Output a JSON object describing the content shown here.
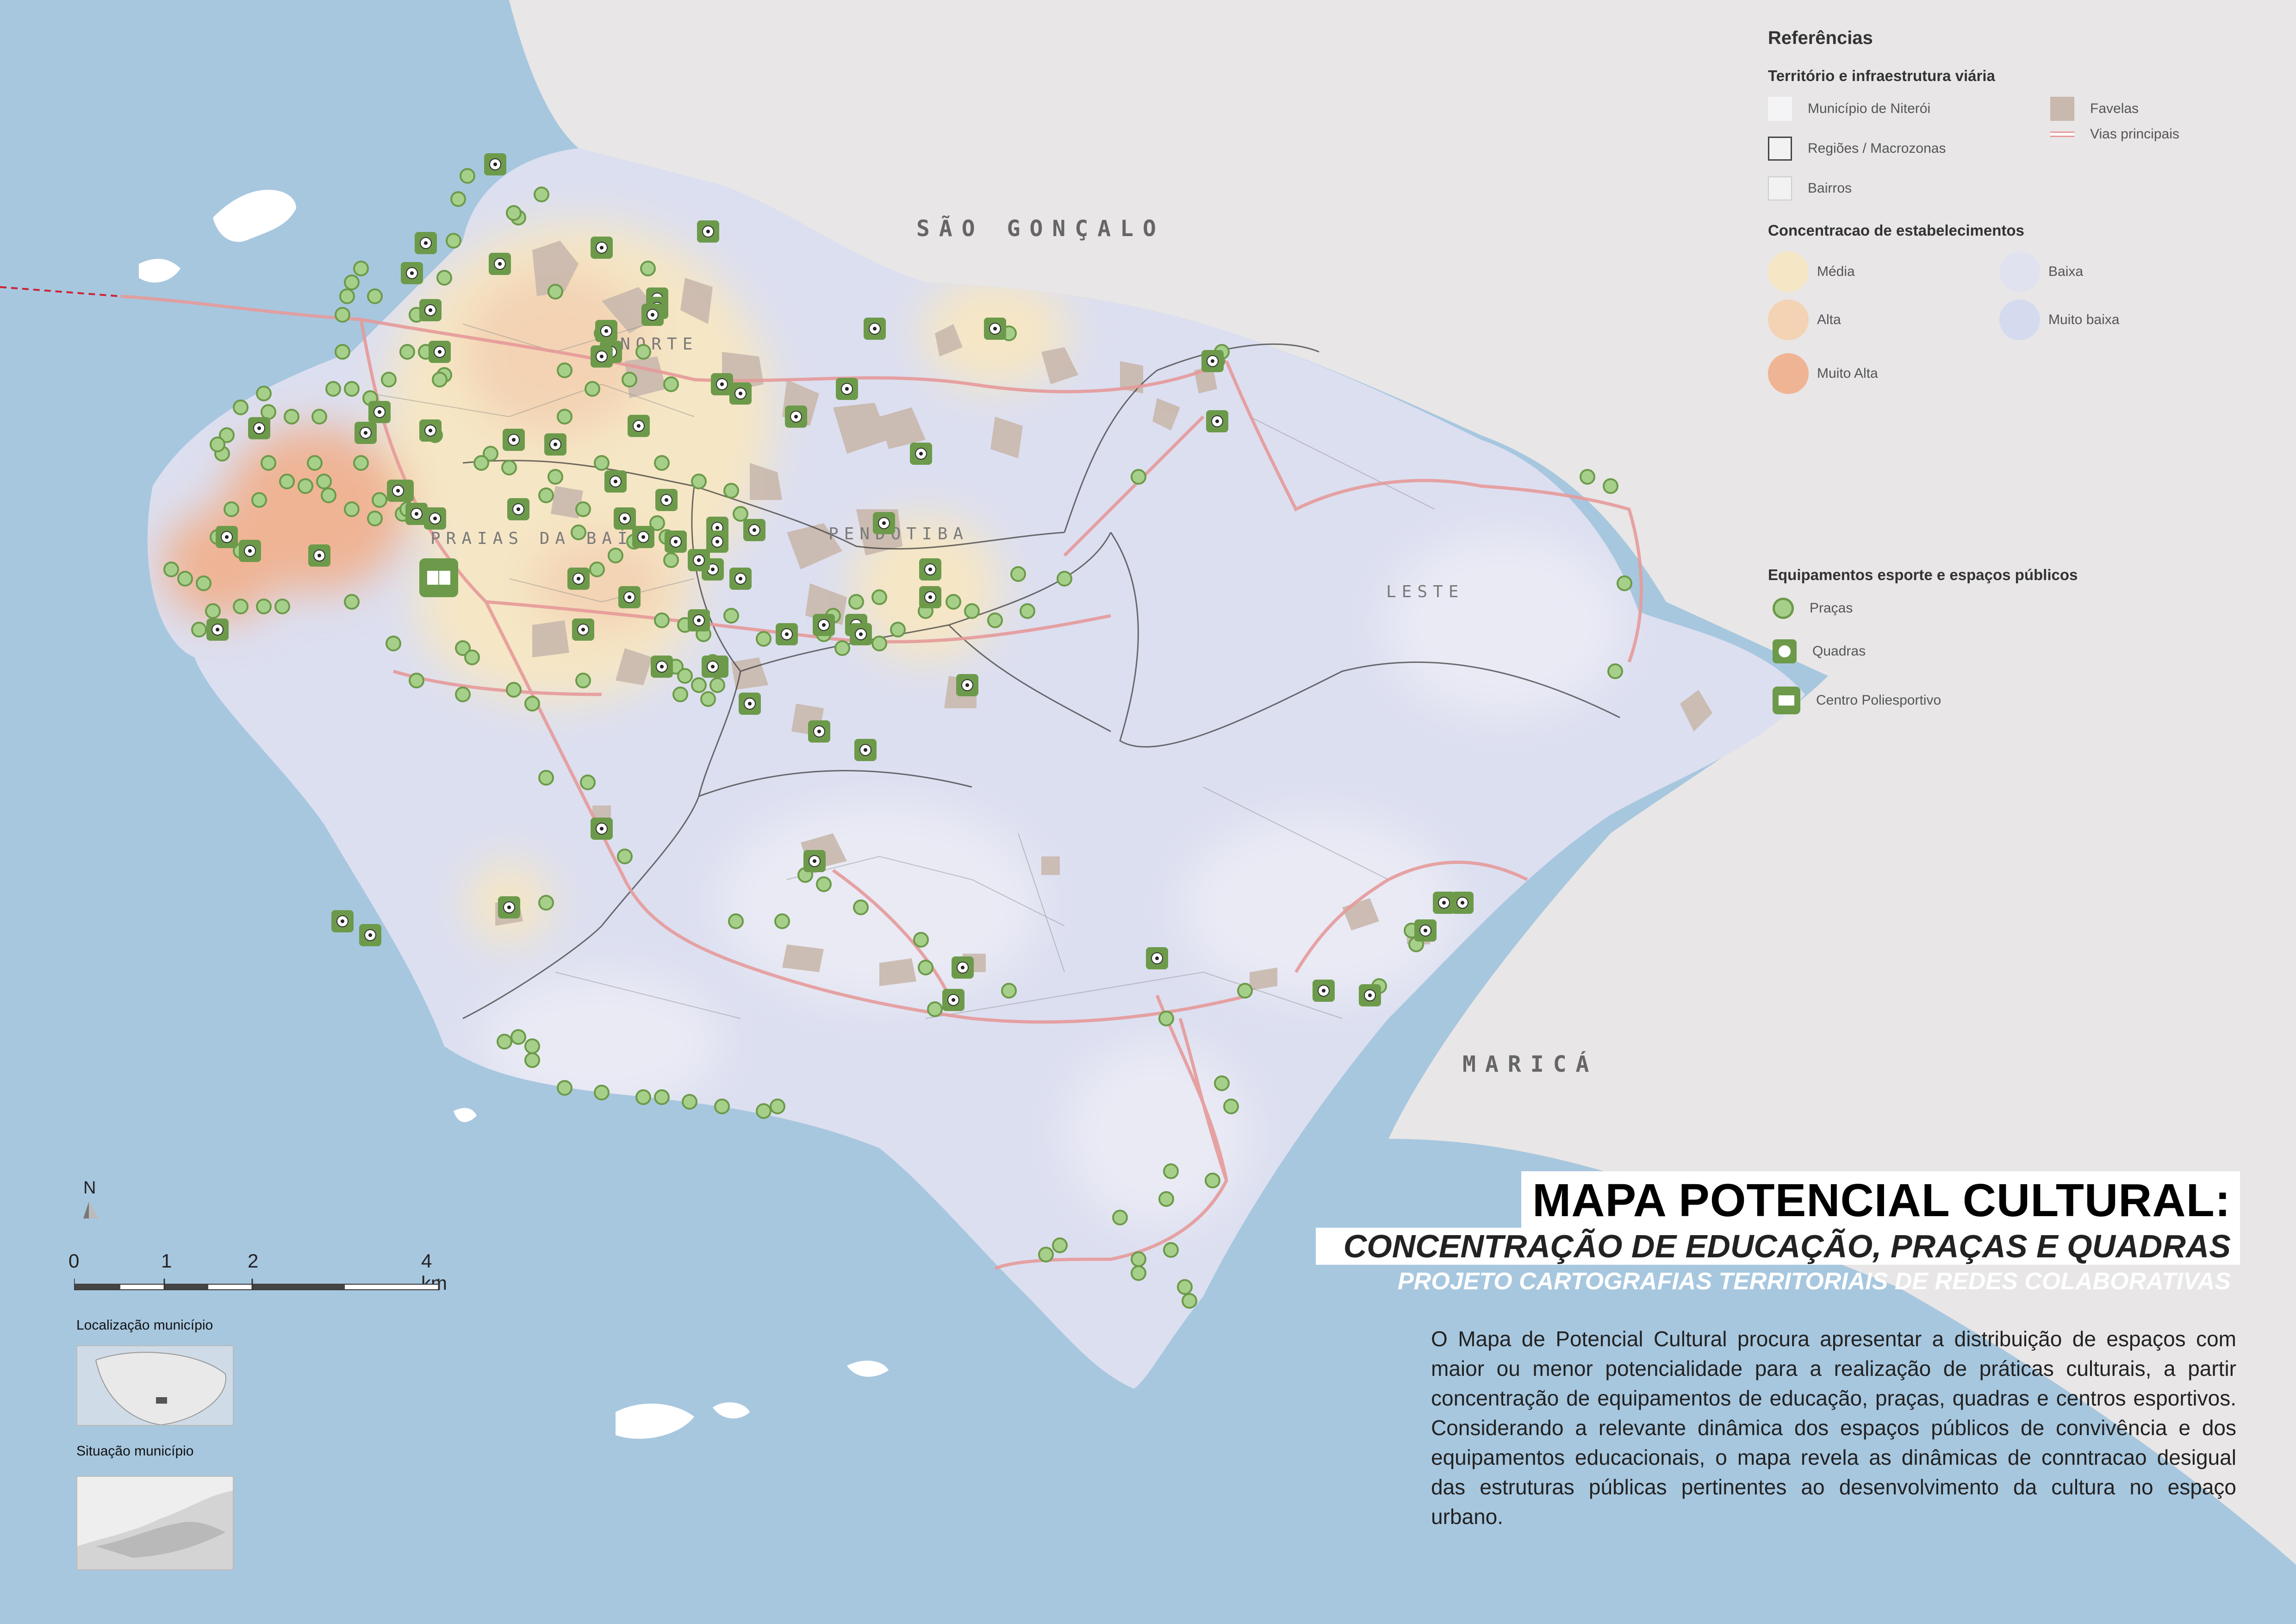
{
  "labels": {
    "sao_goncalo": "SÃO GONÇALO",
    "marica": "MARICÁ",
    "leste": "LESTE",
    "norte": "NORTE",
    "praias": "PRAIAS DA BAÍA",
    "pendotiba": "PENDOTIBA"
  },
  "legend": {
    "title": "Referências",
    "section1": {
      "title": "Território e infraestrutura viária",
      "items": [
        "Município de Niterói",
        "Regiões / Macrozonas",
        "Bairros",
        "Favelas",
        "Vias principais"
      ]
    },
    "section2": {
      "title": "Concentracao de estabelecimentos",
      "items": [
        "Média",
        "Alta",
        "Muito Alta",
        "Baixa",
        "Muito baixa"
      ]
    },
    "section3": {
      "title": "Equipamentos esporte e espaços públicos",
      "items": [
        "Praças",
        "Quadras",
        "Centro Poliesportivo"
      ]
    }
  },
  "title": {
    "main": "MAPA POTENCIAL CULTURAL:",
    "sub": "CONCENTRAÇÃO DE EDUCAÇÃO, PRAÇAS E QUADRAS",
    "project": "PROJETO CARTOGRAFIAS TERRITORIAIS DE REDES COLABORATIVAS"
  },
  "description": "O Mapa de Potencial Cultural procura apresentar a distribuição de espaços com maior ou menor potencialidade para a realização de práticas culturais, a partir concentração de equipamentos de educação, praças, quadras e centros esportivos. Considerando a relevante dinâmica dos espaços públicos de convivência e dos equipamentos educacionais, o mapa revela as dinâmicas de conntracao desigual das estruturas públicas pertinentes ao desenvolvimento da cultura no espaço urbano.",
  "north": "N",
  "scale": {
    "labels": [
      "0",
      "1",
      "2",
      "4 km"
    ]
  },
  "insets": {
    "location": "Localização município",
    "situation": "Situação município"
  },
  "colors": {
    "sea": "#a7c7df",
    "land": "#e8e6e6",
    "municipality": "#dcdff0",
    "low": "#e0e2f0",
    "media": "#f5e6c5",
    "alta": "#f3d3b4",
    "muito_alta": "#efb494",
    "favela": "#c9b8ad",
    "road": "#e69a9a",
    "praca": "#a6d08a",
    "quadra": "#6c9a4a"
  }
}
